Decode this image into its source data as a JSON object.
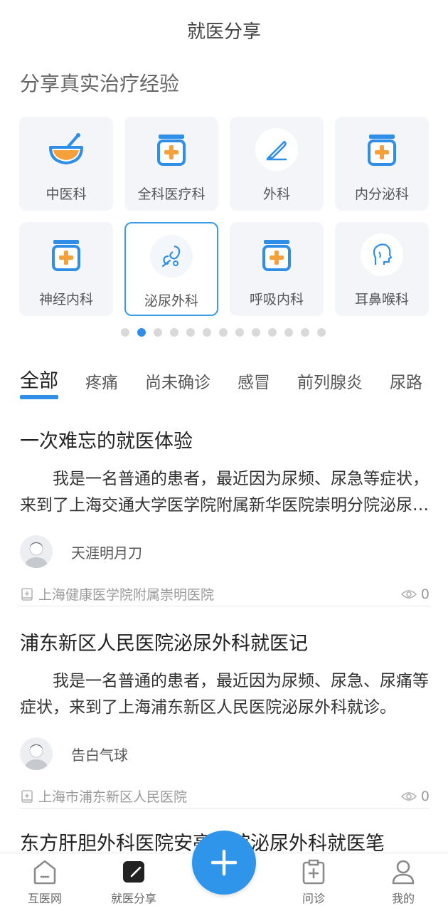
{
  "header": {
    "title": "就医分享"
  },
  "section_title": "分享真实治疗经验",
  "departments": [
    {
      "label": "中医科",
      "icon": "herbal-bowl-icon"
    },
    {
      "label": "全科医疗科",
      "icon": "medicine-box-icon"
    },
    {
      "label": "外科",
      "icon": "scalpel-icon"
    },
    {
      "label": "内分泌科",
      "icon": "medicine-box-icon"
    },
    {
      "label": "神经内科",
      "icon": "medicine-box-icon"
    },
    {
      "label": "泌尿外科",
      "icon": "urology-icon",
      "selected": true
    },
    {
      "label": "呼吸内科",
      "icon": "medicine-box-icon"
    },
    {
      "label": "耳鼻喉科",
      "icon": "ent-head-icon"
    }
  ],
  "pager": {
    "total": 13,
    "active_index": 1
  },
  "tabs": [
    {
      "label": "全部",
      "active": true
    },
    {
      "label": "疼痛"
    },
    {
      "label": "尚未确诊"
    },
    {
      "label": "感冒"
    },
    {
      "label": "前列腺炎"
    },
    {
      "label": "尿路"
    }
  ],
  "posts": [
    {
      "title": "一次难忘的就医体验",
      "excerpt": "我是一名普通的患者，最近因为尿频、尿急等症状，来到了上海交通大学医学院附属新华医院崇明分院泌尿外科就诊。",
      "author": "天涯明月刀",
      "hospital": "上海健康医学院附属崇明医院",
      "views": "0"
    },
    {
      "title": "浦东新区人民医院泌尿外科就医记",
      "excerpt": "我是一名普通的患者，最近因为尿频、尿急、尿痛等症状，来到了上海浦东新区人民医院泌尿外科就诊。",
      "author": "告白气球",
      "hospital": "上海市浦东新区人民医院",
      "views": "0"
    },
    {
      "title": "东方肝胆外科医院安亭新院泌尿外科就医笔"
    }
  ],
  "bottom_nav": {
    "items": [
      {
        "label": "互医网",
        "icon": "home-icon"
      },
      {
        "label": "就医分享",
        "icon": "edit-note-icon",
        "active": true
      },
      {
        "label": "问诊",
        "icon": "clipboard-plus-icon"
      },
      {
        "label": "我的",
        "icon": "user-icon"
      }
    ],
    "fab_icon": "plus-icon"
  },
  "colors": {
    "accent": "#2f8fe6",
    "icon_orange": "#f5a03a",
    "card_bg": "#f3f5f8"
  }
}
